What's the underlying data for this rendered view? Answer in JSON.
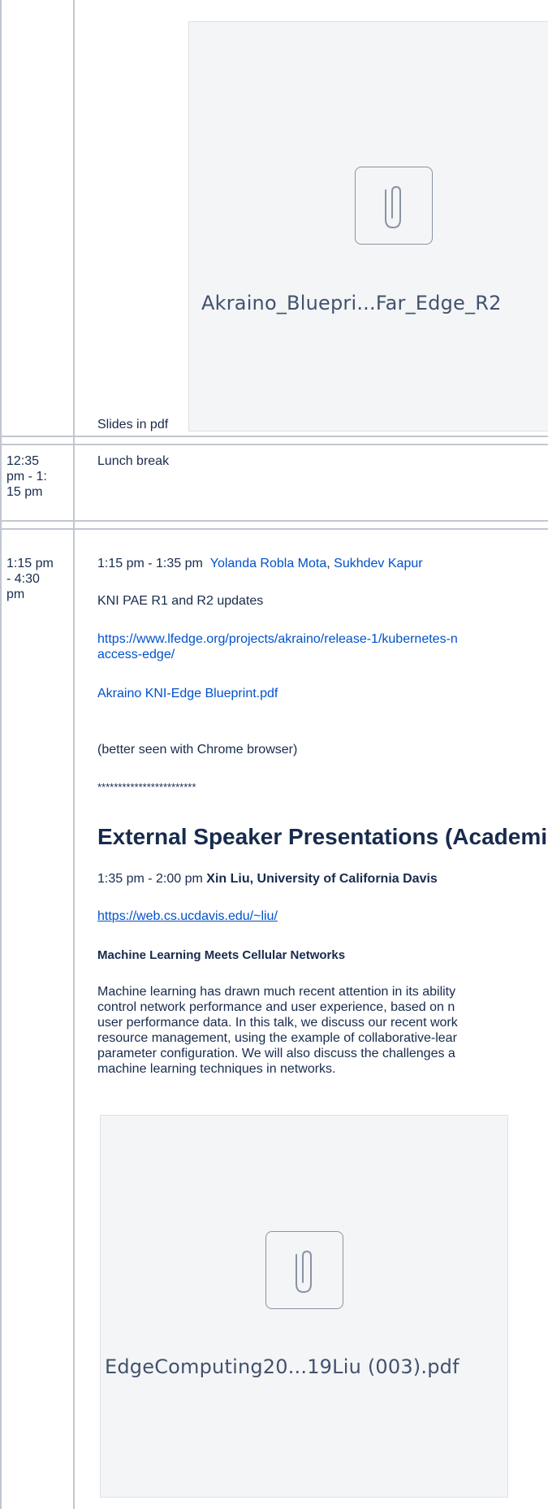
{
  "row1": {
    "attachment_name": "Akraino_Bluepri...Far_Edge_R2",
    "caption": "Slides in pdf"
  },
  "row2": {
    "time": "12:35 pm - 1: 15 pm",
    "time_lines": [
      "12:35",
      "pm - 1:",
      "15 pm"
    ],
    "content": "Lunch break"
  },
  "row3": {
    "time": "1:15 pm - 4:30 pm",
    "time_lines": [
      "1:15 pm",
      "- 4:30",
      "pm"
    ],
    "session_time": "1:15 pm - 1:35 pm",
    "speaker1": "Yolanda Robla Mota",
    "separator": ",",
    "speaker2": "Sukhdev Kapur",
    "topic": "KNI PAE R1 and R2 updates",
    "url_line1": "https://www.lfedge.org/projects/akraino/release-1/kubernetes-n",
    "url_line2": "access-edge/",
    "pdf_link": "Akraino KNI-Edge Blueprint.pdf",
    "note": "(better seen with Chrome browser)",
    "stars": "************************",
    "section_heading": "External Speaker Presentations (Academi",
    "talk_time": "1:35 pm - 2:00 pm",
    "talk_speaker": "Xin Liu, University of California Davis",
    "talk_url": "https://web.cs.ucdavis.edu/~liu/",
    "talk_title": "Machine Learning Meets Cellular Networks",
    "abstract_lines": [
      "Machine learning has drawn much recent attention in its ability",
      "control network performance and user experience, based on n",
      "user performance data. In this talk, we discuss our recent work",
      "resource management, using the example of collaborative-lear",
      "parameter configuration. We will also discuss the challenges a",
      "machine learning techniques in networks."
    ],
    "attachment_name": "EdgeComputing20...19Liu (003).pdf"
  },
  "icons": {
    "attachment": "paperclip-icon"
  },
  "colors": {
    "link": "#0052cc",
    "text": "#172b4d",
    "border": "#c1c7d0",
    "attachment_bg": "#f4f5f7"
  }
}
